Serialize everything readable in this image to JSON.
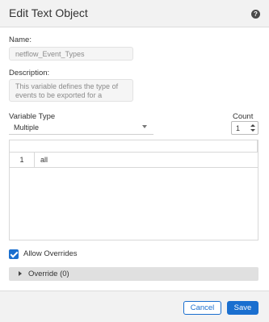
{
  "dialog": {
    "title": "Edit Text Object",
    "help_icon": "?"
  },
  "form": {
    "name_label": "Name:",
    "name_value": "netflow_Event_Types",
    "description_label": "Description:",
    "description_value": "This variable defines the type of events to be exported for a",
    "variable_type_label": "Variable Type",
    "variable_type_value": "Multiple",
    "count_label": "Count",
    "count_value": "1"
  },
  "table": {
    "rows": [
      {
        "index": "1",
        "value": "all"
      }
    ]
  },
  "allow_overrides": {
    "label": "Allow Overrides",
    "checked": true
  },
  "override_section": {
    "label": "Override (0)"
  },
  "footer": {
    "cancel_label": "Cancel",
    "save_label": "Save"
  },
  "colors": {
    "accent": "#1a6fcf",
    "header_bg": "#f2f2f2",
    "override_bg": "#e0e0e0"
  },
  "icons": {
    "help": "help-icon",
    "select_chevron": "chevron-down-icon",
    "stepper": "stepper-arrows-icon",
    "override_caret": "caret-right-icon",
    "checkbox": "checkmark-icon"
  }
}
